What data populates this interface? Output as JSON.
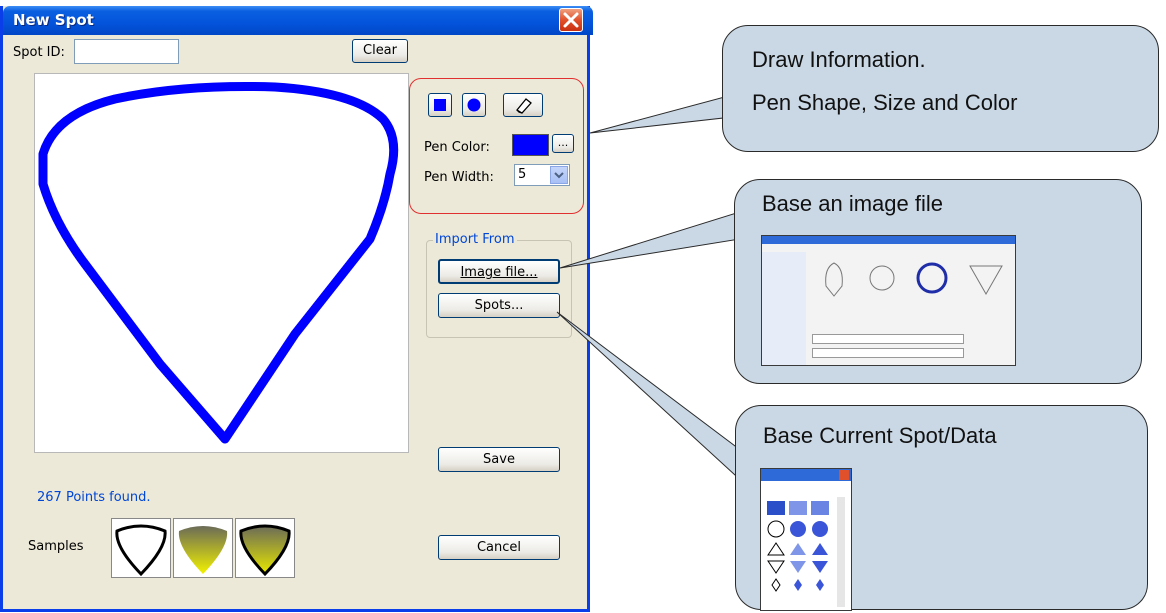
{
  "dialog": {
    "title": "New Spot",
    "spot_id_label": "Spot ID:",
    "spot_id_value": "",
    "clear_label": "Clear",
    "points_found": "267 Points found.",
    "samples_label": "Samples",
    "pen_color_label": "Pen Color:",
    "pen_color": "#0000ff",
    "pen_color_browse": "...",
    "pen_width_label": "Pen Width:",
    "pen_width_value": "5",
    "import_from_label": "Import From",
    "image_file_label": "Image file...",
    "spots_label": "Spots...",
    "save_label": "Save",
    "cancel_label": "Cancel"
  },
  "callouts": {
    "draw_info_line1": "Draw Information.",
    "draw_info_line2": "Pen Shape, Size and Color",
    "base_image": "Base an image file",
    "base_spot": "Base Current Spot/Data"
  },
  "colors": {
    "title_blue": "#0453db",
    "accent_red": "#e03030",
    "stroke_blue": "#0000ff",
    "callout_fill": "#cad8e6"
  }
}
